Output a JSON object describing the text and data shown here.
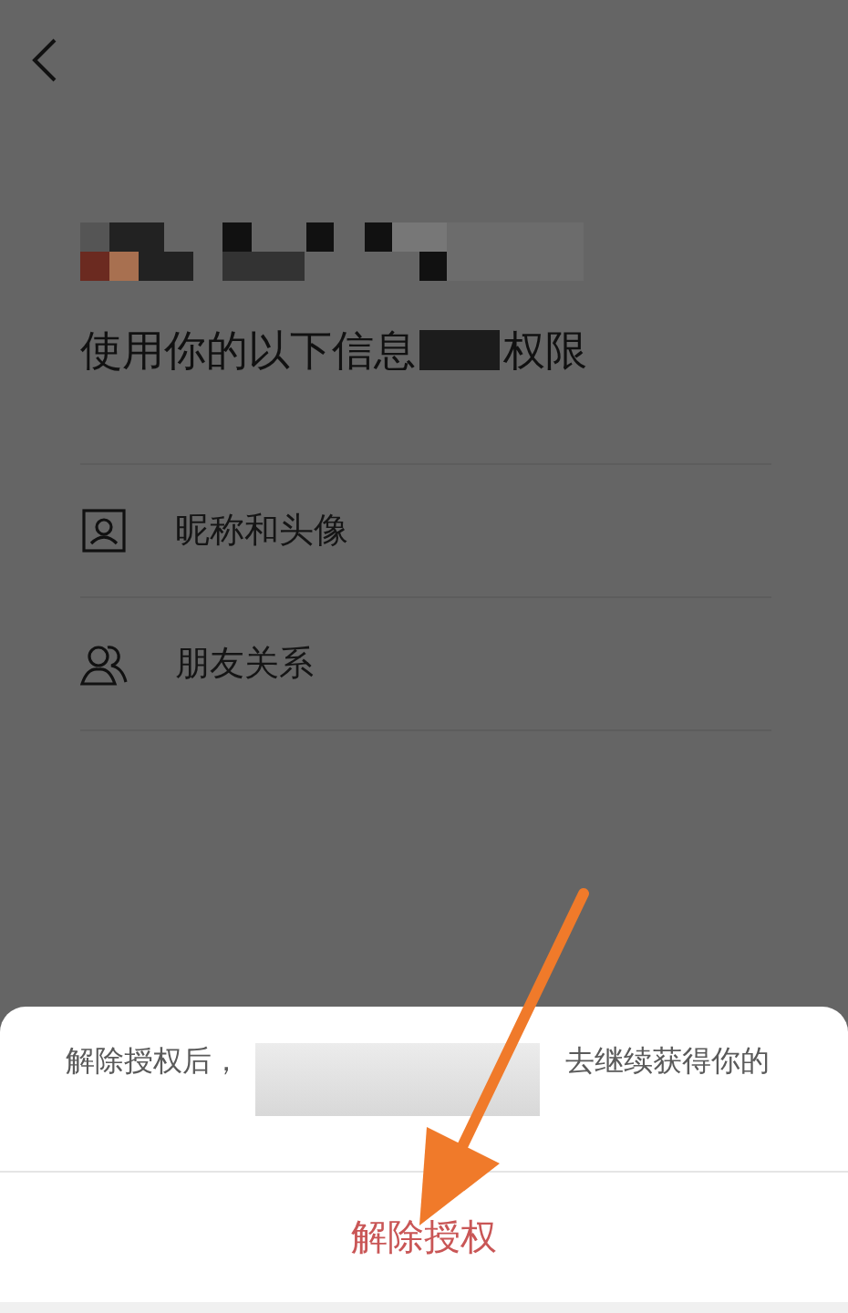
{
  "heading": {
    "before": "使用你的以下信息",
    "after": "权限"
  },
  "permissions": [
    {
      "kind": "profile",
      "label": "昵称和头像"
    },
    {
      "kind": "friends",
      "label": "朋友关系"
    }
  ],
  "sheet": {
    "message_start": "解除授权后，",
    "message_end": "去继续获得你的",
    "action": "解除授权"
  }
}
